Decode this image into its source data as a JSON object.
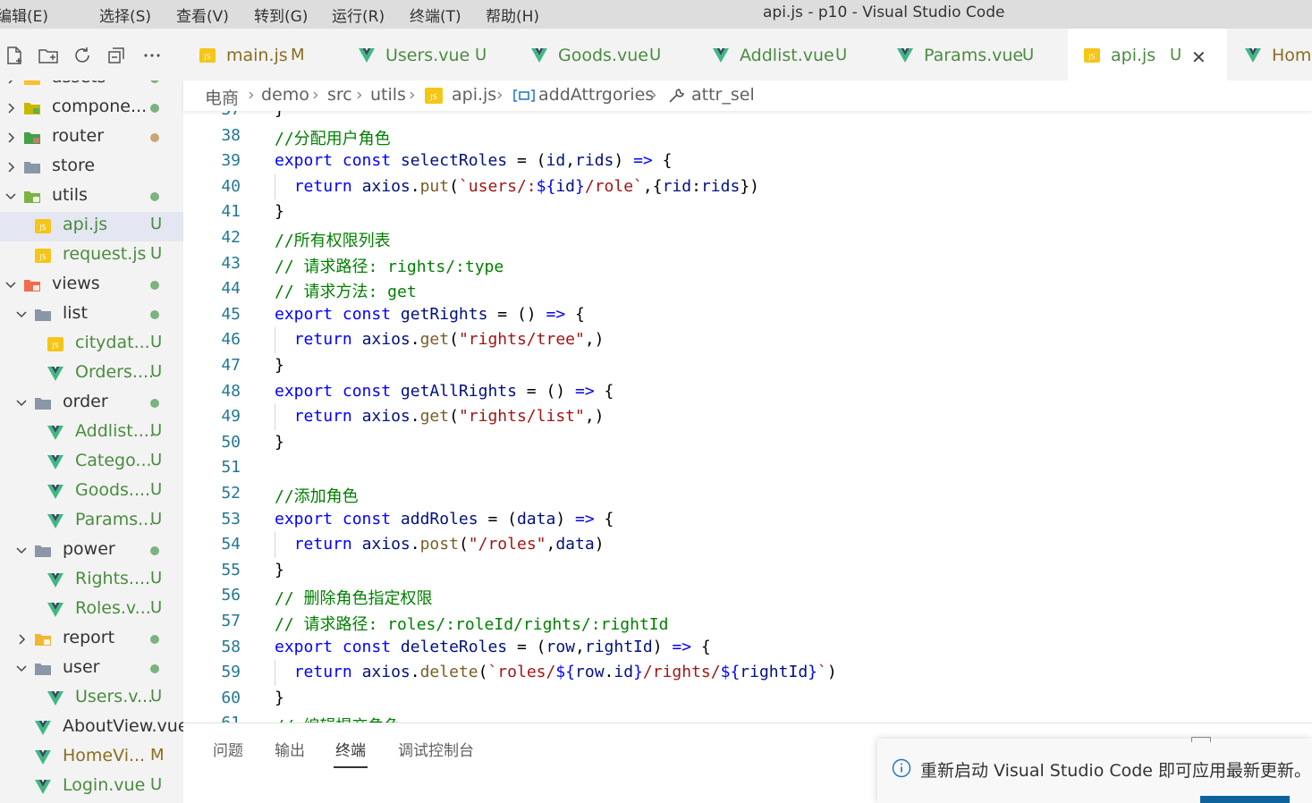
{
  "titlebar": {
    "menus": [
      "编辑(E)",
      "选择(S)",
      "查看(V)",
      "转到(G)",
      "运行(R)",
      "终端(T)",
      "帮助(H)"
    ],
    "window_title": "api.js - p10 - Visual Studio Code"
  },
  "explorer": {
    "items": [
      {
        "label": "assets",
        "icon": "folder-assets-icon",
        "level": 0,
        "expanded": false,
        "badge": "",
        "dot": "green"
      },
      {
        "label": "compone...",
        "icon": "folder-components-icon",
        "level": 0,
        "expanded": false,
        "badge": "",
        "dot": "green"
      },
      {
        "label": "router",
        "icon": "folder-router-icon",
        "level": 0,
        "expanded": false,
        "badge": "",
        "dot": "tan"
      },
      {
        "label": "store",
        "icon": "folder-icon",
        "level": 0,
        "expanded": false,
        "badge": "",
        "dot": ""
      },
      {
        "label": "utils",
        "icon": "folder-utils-icon",
        "level": 0,
        "expanded": true,
        "badge": "",
        "dot": "green"
      },
      {
        "label": "api.js",
        "icon": "js-file-icon",
        "level": 1,
        "file": true,
        "badge": "U",
        "dot": ""
      },
      {
        "label": "request.js",
        "icon": "js-file-icon",
        "level": 1,
        "file": true,
        "badge": "U",
        "dot": ""
      },
      {
        "label": "views",
        "icon": "folder-views-icon",
        "level": 0,
        "expanded": true,
        "badge": "",
        "dot": "green"
      },
      {
        "label": "list",
        "icon": "folder-icon",
        "level": 1,
        "expanded": true,
        "badge": "",
        "dot": "green"
      },
      {
        "label": "citydat...",
        "icon": "js-file-icon",
        "level": 2,
        "file": true,
        "badge": "U",
        "dot": ""
      },
      {
        "label": "Orders....",
        "icon": "vue-file-icon",
        "level": 2,
        "file": true,
        "badge": "U",
        "dot": ""
      },
      {
        "label": "order",
        "icon": "folder-icon",
        "level": 1,
        "expanded": true,
        "badge": "",
        "dot": "green"
      },
      {
        "label": "Addlist....",
        "icon": "vue-file-icon",
        "level": 2,
        "file": true,
        "badge": "U",
        "dot": ""
      },
      {
        "label": "Catego...",
        "icon": "vue-file-icon",
        "level": 2,
        "file": true,
        "badge": "U",
        "dot": ""
      },
      {
        "label": "Goods....",
        "icon": "vue-file-icon",
        "level": 2,
        "file": true,
        "badge": "U",
        "dot": ""
      },
      {
        "label": "Params...",
        "icon": "vue-file-icon",
        "level": 2,
        "file": true,
        "badge": "U",
        "dot": ""
      },
      {
        "label": "power",
        "icon": "folder-icon",
        "level": 1,
        "expanded": true,
        "badge": "",
        "dot": "green"
      },
      {
        "label": "Rights....",
        "icon": "vue-file-icon",
        "level": 2,
        "file": true,
        "badge": "U",
        "dot": ""
      },
      {
        "label": "Roles.v...",
        "icon": "vue-file-icon",
        "level": 2,
        "file": true,
        "badge": "U",
        "dot": ""
      },
      {
        "label": "report",
        "icon": "folder-report-icon",
        "level": 1,
        "expanded": false,
        "badge": "",
        "dot": "green"
      },
      {
        "label": "user",
        "icon": "folder-icon",
        "level": 1,
        "expanded": true,
        "badge": "",
        "dot": "green"
      },
      {
        "label": "Users.v...",
        "icon": "vue-file-icon",
        "level": 2,
        "file": true,
        "badge": "U",
        "dot": ""
      },
      {
        "label": "AboutView.vue",
        "icon": "vue-file-icon",
        "level": 1,
        "file": true,
        "badge": "",
        "dot": ""
      },
      {
        "label": "HomeVi...",
        "icon": "vue-file-icon",
        "level": 1,
        "file": true,
        "badge": "M",
        "dot": ""
      },
      {
        "label": "Login.vue",
        "icon": "vue-file-icon",
        "level": 1,
        "file": true,
        "badge": "U",
        "dot": ""
      }
    ],
    "selected_index": 5
  },
  "tabs": [
    {
      "label": "main.js",
      "icon": "js-file-icon",
      "badge": "M",
      "active": false
    },
    {
      "label": "Users.vue",
      "icon": "vue-file-icon",
      "badge": "U",
      "active": false
    },
    {
      "label": "Goods.vue",
      "icon": "vue-file-icon",
      "badge": "U",
      "active": false
    },
    {
      "label": "Addlist.vue",
      "icon": "vue-file-icon",
      "badge": "U",
      "active": false
    },
    {
      "label": "Params.vue",
      "icon": "vue-file-icon",
      "badge": "U",
      "active": false
    },
    {
      "label": "api.js",
      "icon": "js-file-icon",
      "badge": "U",
      "active": true
    },
    {
      "label": "Home",
      "icon": "vue-file-icon",
      "badge": "",
      "active": false
    }
  ],
  "breadcrumb": [
    "电商",
    "demo",
    "src",
    "utils",
    "api.js",
    "addAttrgories",
    "attr_sel"
  ],
  "code": {
    "first_line": 37,
    "lines": [
      [
        [
          "}",
          "op"
        ]
      ],
      [
        [
          "//分配用户角色",
          "cm"
        ]
      ],
      [
        [
          "export",
          "kw"
        ],
        [
          " ",
          "op"
        ],
        [
          "const",
          "kw"
        ],
        [
          " ",
          "op"
        ],
        [
          "selectRoles",
          "var"
        ],
        [
          " = (",
          "op"
        ],
        [
          "id",
          "var"
        ],
        [
          ",",
          "op"
        ],
        [
          "rids",
          "var"
        ],
        [
          ") ",
          "op"
        ],
        [
          "=>",
          "kw"
        ],
        [
          " {",
          "op"
        ]
      ],
      [
        [
          "  ",
          "op"
        ],
        [
          "return",
          "kw"
        ],
        [
          " ",
          "op"
        ],
        [
          "axios",
          "var"
        ],
        [
          ".",
          "op"
        ],
        [
          "put",
          "fn"
        ],
        [
          "(",
          "op"
        ],
        [
          "`users/:",
          "str"
        ],
        [
          "${",
          "kw"
        ],
        [
          "id",
          "var"
        ],
        [
          "}",
          "kw"
        ],
        [
          "/role`",
          "str"
        ],
        [
          ",{",
          "op"
        ],
        [
          "rid",
          "var"
        ],
        [
          ":",
          "op"
        ],
        [
          "rids",
          "var"
        ],
        [
          "})",
          "op"
        ]
      ],
      [
        [
          "}",
          "op"
        ]
      ],
      [
        [
          "//所有权限列表",
          "cm"
        ]
      ],
      [
        [
          "// 请求路径: rights/:type",
          "cm"
        ]
      ],
      [
        [
          "// 请求方法: get",
          "cm"
        ]
      ],
      [
        [
          "export",
          "kw"
        ],
        [
          " ",
          "op"
        ],
        [
          "const",
          "kw"
        ],
        [
          " ",
          "op"
        ],
        [
          "getRights",
          "var"
        ],
        [
          " = () ",
          "op"
        ],
        [
          "=>",
          "kw"
        ],
        [
          " {",
          "op"
        ]
      ],
      [
        [
          "  ",
          "op"
        ],
        [
          "return",
          "kw"
        ],
        [
          " ",
          "op"
        ],
        [
          "axios",
          "var"
        ],
        [
          ".",
          "op"
        ],
        [
          "get",
          "fn"
        ],
        [
          "(",
          "op"
        ],
        [
          "\"rights/tree\"",
          "str"
        ],
        [
          ",)",
          "op"
        ]
      ],
      [
        [
          "}",
          "op"
        ]
      ],
      [
        [
          "export",
          "kw"
        ],
        [
          " ",
          "op"
        ],
        [
          "const",
          "kw"
        ],
        [
          " ",
          "op"
        ],
        [
          "getAllRights",
          "var"
        ],
        [
          " = () ",
          "op"
        ],
        [
          "=>",
          "kw"
        ],
        [
          " {",
          "op"
        ]
      ],
      [
        [
          "  ",
          "op"
        ],
        [
          "return",
          "kw"
        ],
        [
          " ",
          "op"
        ],
        [
          "axios",
          "var"
        ],
        [
          ".",
          "op"
        ],
        [
          "get",
          "fn"
        ],
        [
          "(",
          "op"
        ],
        [
          "\"rights/list\"",
          "str"
        ],
        [
          ",)",
          "op"
        ]
      ],
      [
        [
          "}",
          "op"
        ]
      ],
      [],
      [
        [
          "//添加角色",
          "cm"
        ]
      ],
      [
        [
          "export",
          "kw"
        ],
        [
          " ",
          "op"
        ],
        [
          "const",
          "kw"
        ],
        [
          " ",
          "op"
        ],
        [
          "addRoles",
          "var"
        ],
        [
          " = (",
          "op"
        ],
        [
          "data",
          "var"
        ],
        [
          ") ",
          "op"
        ],
        [
          "=>",
          "kw"
        ],
        [
          " {",
          "op"
        ]
      ],
      [
        [
          "  ",
          "op"
        ],
        [
          "return",
          "kw"
        ],
        [
          " ",
          "op"
        ],
        [
          "axios",
          "var"
        ],
        [
          ".",
          "op"
        ],
        [
          "post",
          "fn"
        ],
        [
          "(",
          "op"
        ],
        [
          "\"/roles\"",
          "str"
        ],
        [
          ",",
          "op"
        ],
        [
          "data",
          "var"
        ],
        [
          ")",
          "op"
        ]
      ],
      [
        [
          "}",
          "op"
        ]
      ],
      [
        [
          "// 删除角色指定权限",
          "cm"
        ]
      ],
      [
        [
          "// 请求路径: roles/:roleId/rights/:rightId",
          "cm"
        ]
      ],
      [
        [
          "export",
          "kw"
        ],
        [
          " ",
          "op"
        ],
        [
          "const",
          "kw"
        ],
        [
          " ",
          "op"
        ],
        [
          "deleteRoles",
          "var"
        ],
        [
          " = (",
          "op"
        ],
        [
          "row",
          "var"
        ],
        [
          ",",
          "op"
        ],
        [
          "rightId",
          "var"
        ],
        [
          ") ",
          "op"
        ],
        [
          "=>",
          "kw"
        ],
        [
          " {",
          "op"
        ]
      ],
      [
        [
          "  ",
          "op"
        ],
        [
          "return",
          "kw"
        ],
        [
          " ",
          "op"
        ],
        [
          "axios",
          "var"
        ],
        [
          ".",
          "op"
        ],
        [
          "delete",
          "fn"
        ],
        [
          "(",
          "op"
        ],
        [
          "`roles/",
          "str"
        ],
        [
          "${",
          "kw"
        ],
        [
          "row",
          "var"
        ],
        [
          ".",
          "op"
        ],
        [
          "id",
          "var"
        ],
        [
          "}",
          "kw"
        ],
        [
          "/rights/",
          "str"
        ],
        [
          "${",
          "kw"
        ],
        [
          "rightId",
          "var"
        ],
        [
          "}",
          "kw"
        ],
        [
          "`",
          "str"
        ],
        [
          ")",
          "op"
        ]
      ],
      [
        [
          "}",
          "op"
        ]
      ],
      [
        [
          "// 编辑提交角色",
          "cm"
        ]
      ]
    ]
  },
  "panel": {
    "tabs": [
      "问题",
      "输出",
      "终端",
      "调试控制台"
    ],
    "active": 2
  },
  "notification": {
    "text": "重新启动 Visual Studio Code 即可应用最新更新。"
  },
  "colors": {
    "accent": "#0e639c",
    "vue_green": "#41b883",
    "js_yellow": "#f5c518",
    "untracked": "#4a8c3f",
    "modified": "#8a6d1e",
    "line_number": "#237893"
  }
}
